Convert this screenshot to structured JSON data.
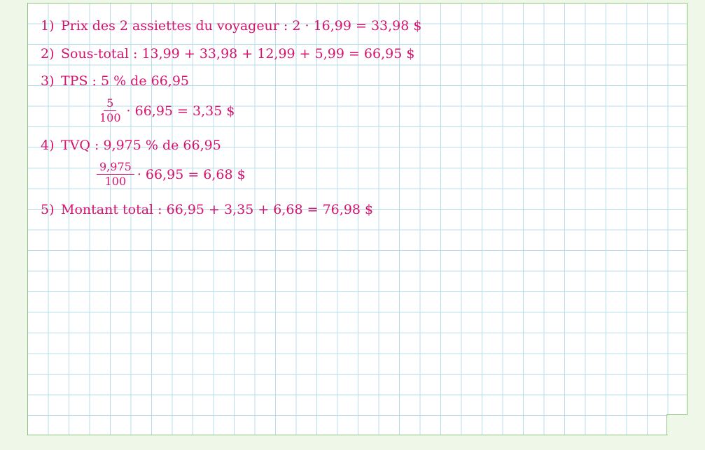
{
  "lines": [
    {
      "n": "1)",
      "text": "Prix des 2 assiettes du voyageur : 2 · 16,99 = 33,98 $"
    },
    {
      "n": "2)",
      "text": "Sous-total : 13,99 + 33,98 + 12,99 + 5,99 = 66,95 $"
    },
    {
      "n": "3)",
      "text": "TPS : 5 % de 66,95"
    },
    {
      "n": "4)",
      "text": "TVQ : 9,975 % de 66,95"
    },
    {
      "n": "5)",
      "text": "Montant total : 66,95 + 3,35 + 6,68 = 76,98 $"
    }
  ],
  "fractions": [
    {
      "num": "5",
      "den": "100",
      "rest": "· 66,95 = 3,35 $"
    },
    {
      "num": "9,975",
      "den": "100",
      "rest": "· 66,95 = 6,68 $"
    }
  ],
  "colors": {
    "text": "#d6136e",
    "grid": "#b8dcec",
    "border": "#8cc47c"
  }
}
